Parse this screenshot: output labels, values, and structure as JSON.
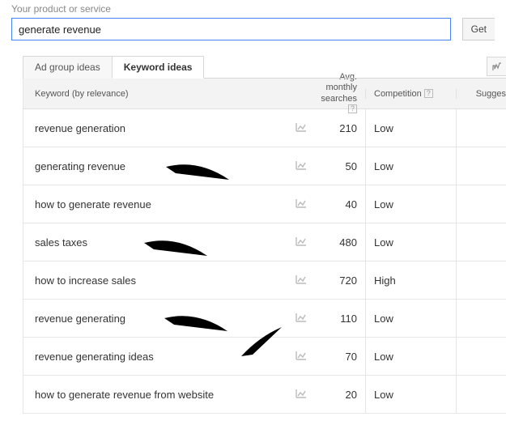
{
  "search": {
    "label": "Your product or service",
    "value": "generate revenue",
    "button": "Get"
  },
  "tabs": {
    "ad_group": "Ad group ideas",
    "keyword": "Keyword ideas"
  },
  "columns": {
    "keyword": "Keyword (by relevance)",
    "searches_l1": "Avg. monthly",
    "searches_l2": "searches",
    "competition": "Competition",
    "suggested": "Sugges"
  },
  "rows": [
    {
      "keyword": "revenue generation",
      "searches": "210",
      "competition": "Low"
    },
    {
      "keyword": "generating revenue",
      "searches": "50",
      "competition": "Low"
    },
    {
      "keyword": "how to generate revenue",
      "searches": "40",
      "competition": "Low"
    },
    {
      "keyword": "sales taxes",
      "searches": "480",
      "competition": "Low"
    },
    {
      "keyword": "how to increase sales",
      "searches": "720",
      "competition": "High"
    },
    {
      "keyword": "revenue generating",
      "searches": "110",
      "competition": "Low"
    },
    {
      "keyword": "revenue generating ideas",
      "searches": "70",
      "competition": "Low"
    },
    {
      "keyword": "how to generate revenue from website",
      "searches": "20",
      "competition": "Low"
    }
  ]
}
